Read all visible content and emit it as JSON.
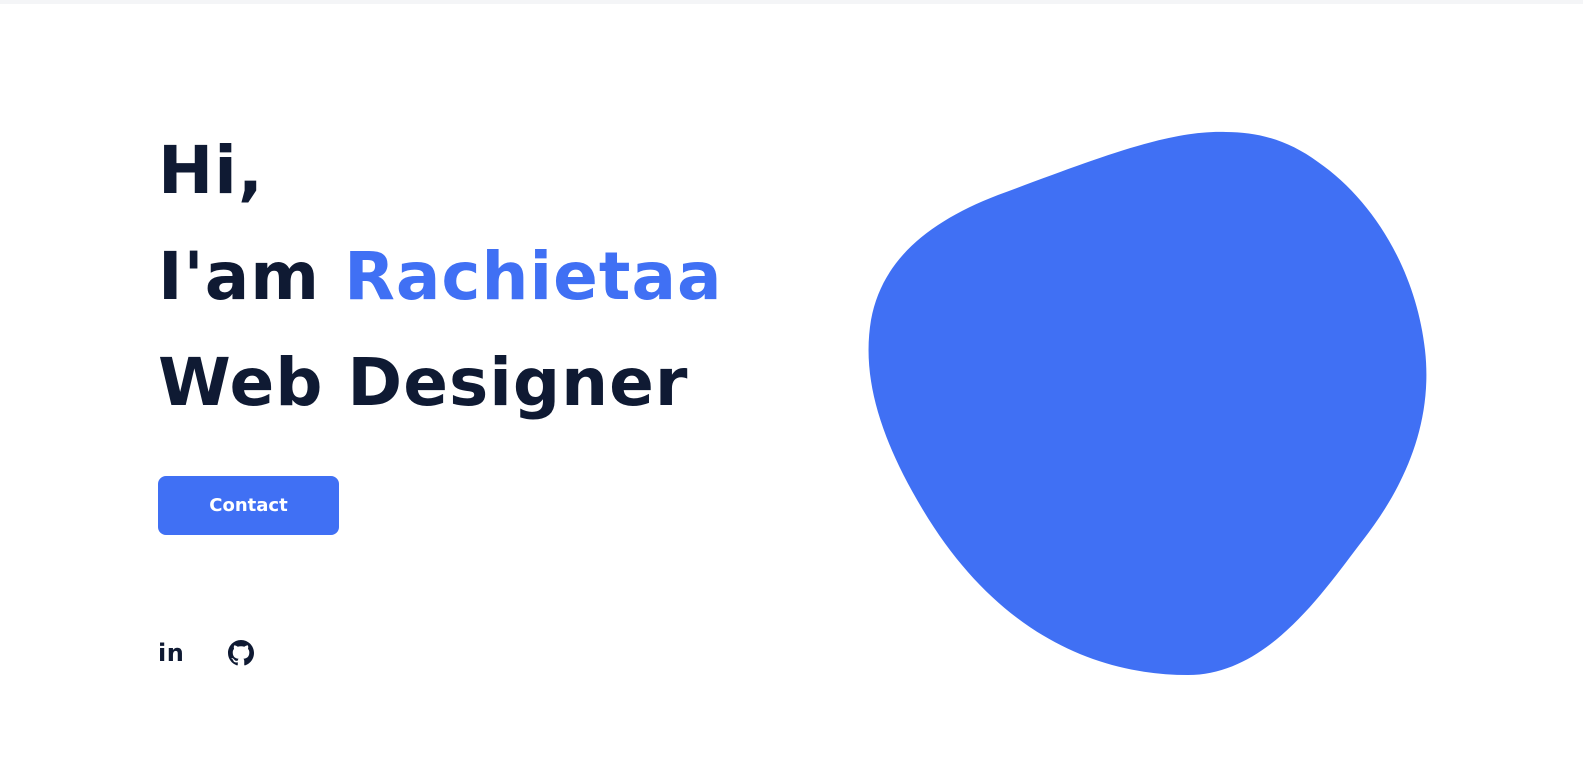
{
  "hero": {
    "greeting": "Hi,",
    "intro_prefix": "I'am",
    "name": "Rachietaa",
    "role": "Web Designer"
  },
  "contact_button": {
    "label": "Contact"
  },
  "socials": [
    {
      "icon": "linkedin-icon",
      "glyph": "in"
    },
    {
      "icon": "github-icon"
    }
  ],
  "colors": {
    "accent": "#4070f4",
    "text_dark": "#0f1a33",
    "background": "#ffffff"
  }
}
